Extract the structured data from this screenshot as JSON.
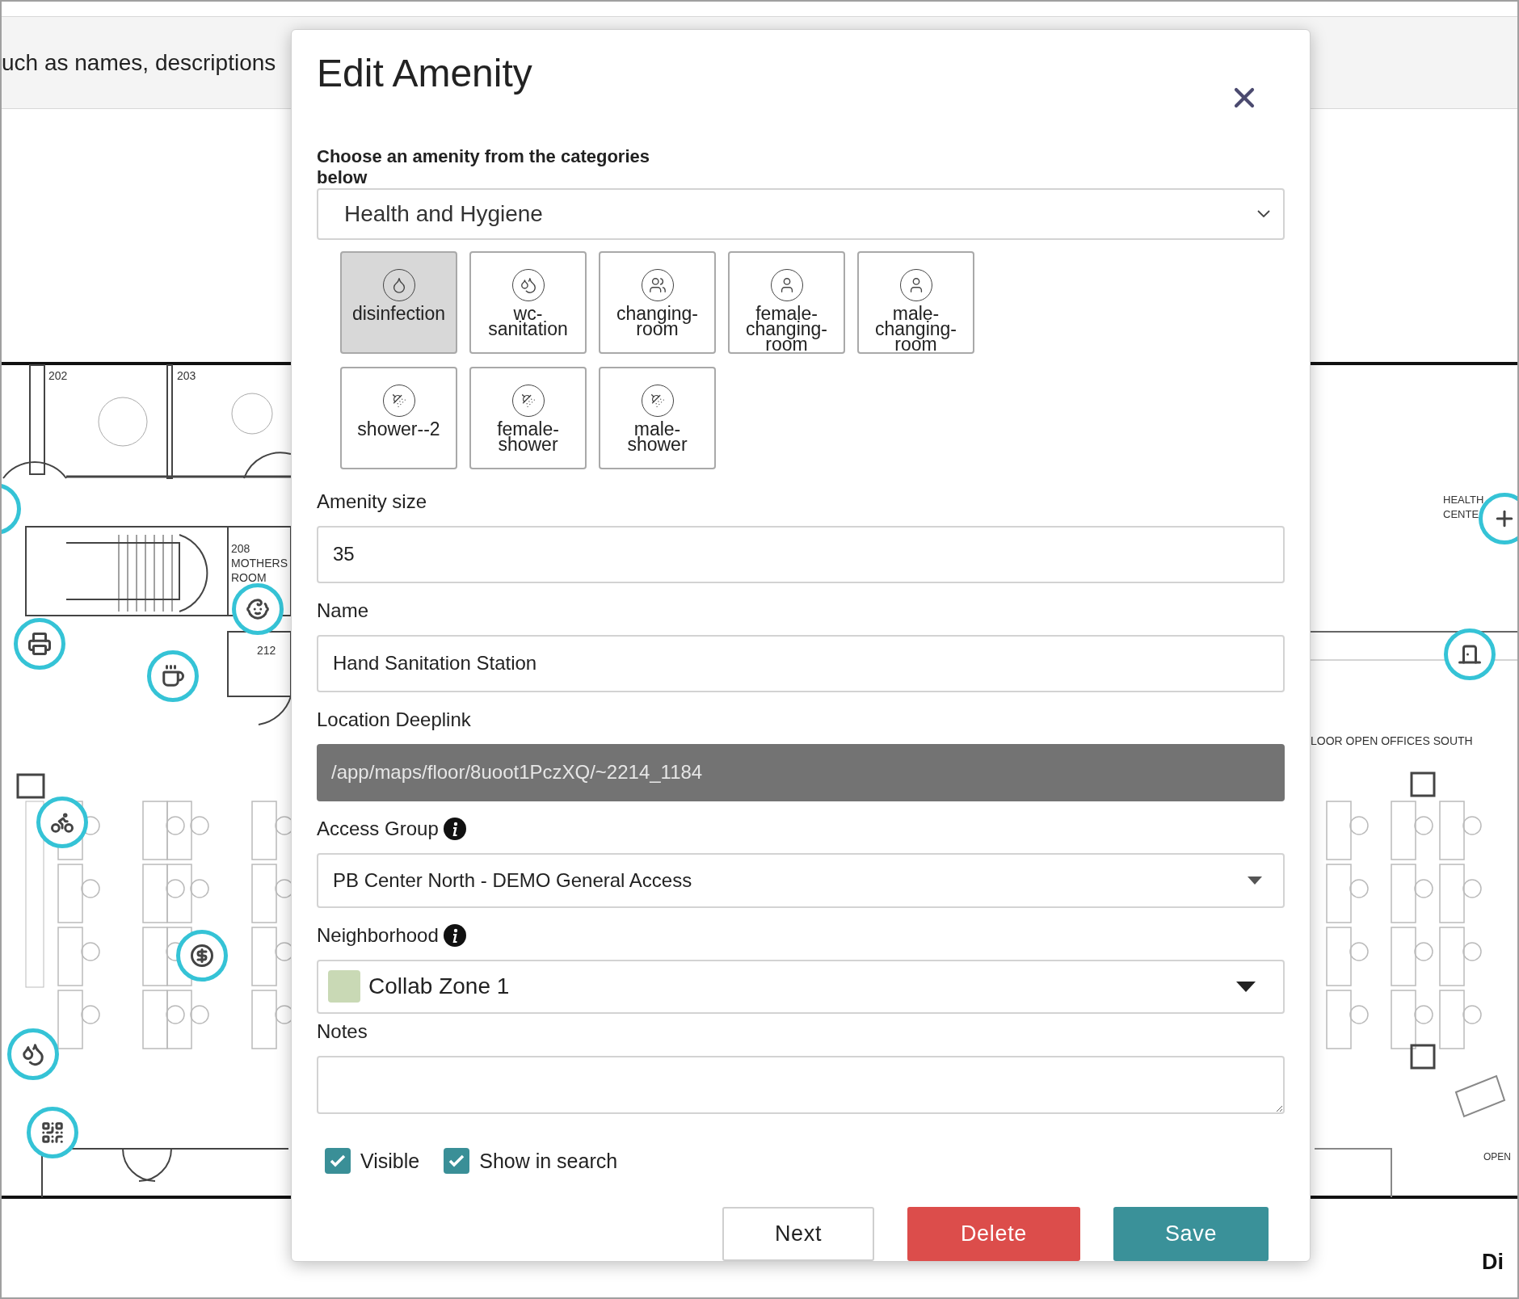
{
  "background": {
    "header_text": "uch as names, descriptions",
    "map_labels": [
      "202",
      "203",
      "208",
      "MOTHERS",
      "ROOM",
      "212",
      "HEALTH",
      "CENTE",
      "LOOR OPEN OFFICES SOUTH",
      "OPEN"
    ],
    "corner_text": "Di"
  },
  "modal": {
    "title": "Edit Amenity",
    "category": {
      "label": "Choose an amenity from the categories below",
      "value": "Health and Hygiene"
    },
    "amenities": [
      {
        "label": "disinfection",
        "selected": true
      },
      {
        "label": "wc-sanitation",
        "selected": false
      },
      {
        "label": "changing-room",
        "selected": false
      },
      {
        "label": "female-changing-room",
        "selected": false
      },
      {
        "label": "male-changing-room",
        "selected": false
      },
      {
        "label": "shower--2",
        "selected": false
      },
      {
        "label": "female-shower",
        "selected": false
      },
      {
        "label": "male-shower",
        "selected": false
      }
    ],
    "amenity_size": {
      "label": "Amenity size",
      "value": "35"
    },
    "name": {
      "label": "Name",
      "value": "Hand Sanitation Station"
    },
    "location_deeplink": {
      "label": "Location Deeplink",
      "value": "/app/maps/floor/8uoot1PczXQ/~2214_1184",
      "disabled": true
    },
    "access_group": {
      "label": "Access Group",
      "value": "PB Center North - DEMO General Access"
    },
    "neighborhood": {
      "label": "Neighborhood",
      "value": "Collab Zone 1",
      "color": "#c9d9b5"
    },
    "notes": {
      "label": "Notes"
    },
    "checkboxes": [
      {
        "label": "Visible",
        "checked": true
      },
      {
        "label": "Show in search",
        "checked": true
      }
    ],
    "buttons": [
      {
        "label": "Next",
        "kind": "secondary"
      },
      {
        "label": "Delete",
        "kind": "danger"
      },
      {
        "label": "Save",
        "kind": "primary"
      }
    ]
  }
}
